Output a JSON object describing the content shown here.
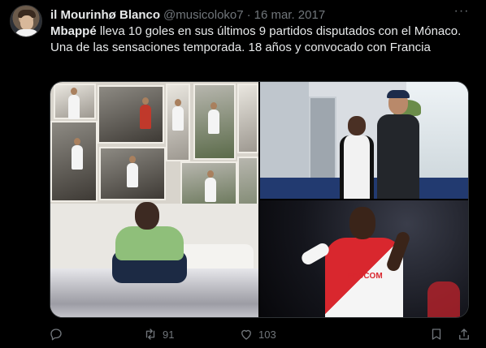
{
  "tweet": {
    "author_name": "il Mourinhø Blanco",
    "handle": "@musicoloko7",
    "separator": "·",
    "date": "16 mar. 2017",
    "more_label": "···",
    "text_bold": "Mbappé",
    "text_rest": " lleva 10 goles en sus últimos 9 partidos disputados con el Mónaco. Una de las sensaciones temporada. 18 años y convocado con Francia",
    "media_sponsor": "FEDCOM"
  },
  "actions": {
    "reply_count": "",
    "retweet_count": "91",
    "like_count": "103",
    "icons": [
      "reply-icon",
      "retweet-icon",
      "like-icon",
      "bookmark-icon",
      "share-icon"
    ]
  },
  "colors": {
    "background": "#000000",
    "text": "#e7e9ea",
    "muted": "#71767b"
  }
}
